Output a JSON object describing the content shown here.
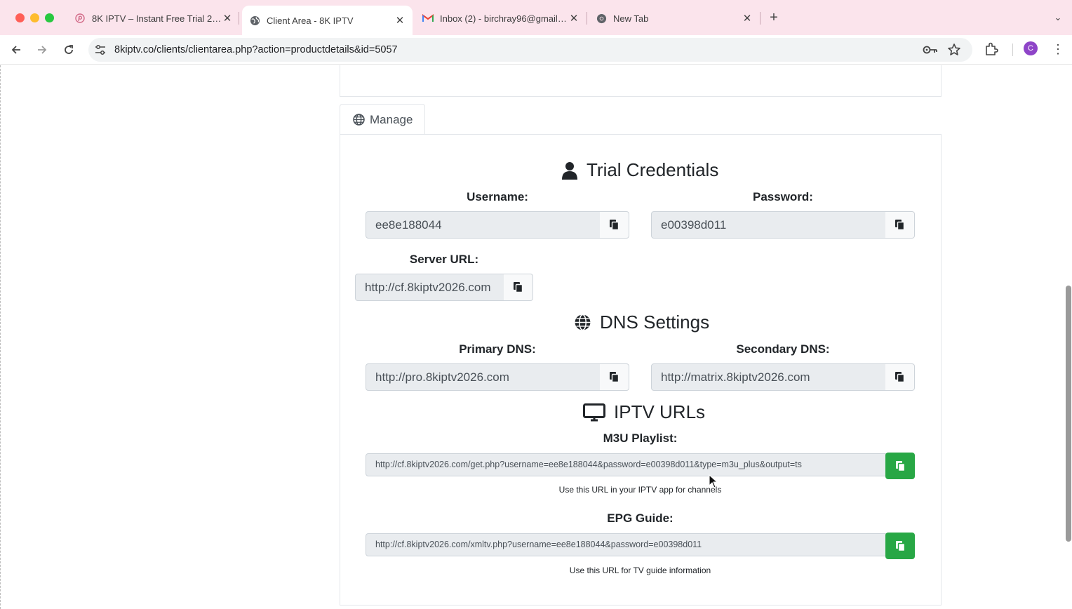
{
  "browser": {
    "tabs": [
      {
        "title": "8K IPTV – Instant Free Trial 2…",
        "icon": "pinterest-icon",
        "active": false
      },
      {
        "title": "Client Area - 8K IPTV",
        "icon": "globe-icon",
        "active": true
      },
      {
        "title": "Inbox (2) - birchray96@gmail…",
        "icon": "gmail-icon",
        "active": false
      },
      {
        "title": "New Tab",
        "icon": "chrome-icon",
        "active": false
      }
    ],
    "new_tab_symbol": "+",
    "tab_close_symbol": "✕",
    "tab_menu_symbol": "⌄",
    "url": "8kiptv.co/clients/clientarea.php?action=productdetails&id=5057",
    "profile_initial": "C",
    "menu_symbol": "⋮"
  },
  "manage_tab": {
    "label": "Manage",
    "icon": "globe-icon"
  },
  "credentials": {
    "title": "Trial Credentials",
    "icon": "user-icon",
    "username_label": "Username:",
    "username_value": "ee8e188044",
    "password_label": "Password:",
    "password_value": "e00398d011",
    "server_label": "Server URL:",
    "server_value": "http://cf.8kiptv2026.com"
  },
  "dns": {
    "title": "DNS Settings",
    "icon": "globe-icon",
    "primary_label": "Primary DNS:",
    "primary_value": "http://pro.8kiptv2026.com",
    "secondary_label": "Secondary DNS:",
    "secondary_value": "http://matrix.8kiptv2026.com"
  },
  "iptv": {
    "title": "IPTV URLs",
    "icon": "monitor-icon",
    "m3u_label": "M3U Playlist:",
    "m3u_value": "http://cf.8kiptv2026.com/get.php?username=ee8e188044&password=e00398d011&type=m3u_plus&output=ts",
    "m3u_hint": "Use this URL in your IPTV app for channels",
    "epg_label": "EPG Guide:",
    "epg_value": "http://cf.8kiptv2026.com/xmltv.php?username=ee8e188044&password=e00398d011",
    "epg_hint": "Use this URL for TV guide information"
  },
  "colors": {
    "accent_green": "#28a745",
    "tab_bar_pink": "#fbe4ec"
  }
}
